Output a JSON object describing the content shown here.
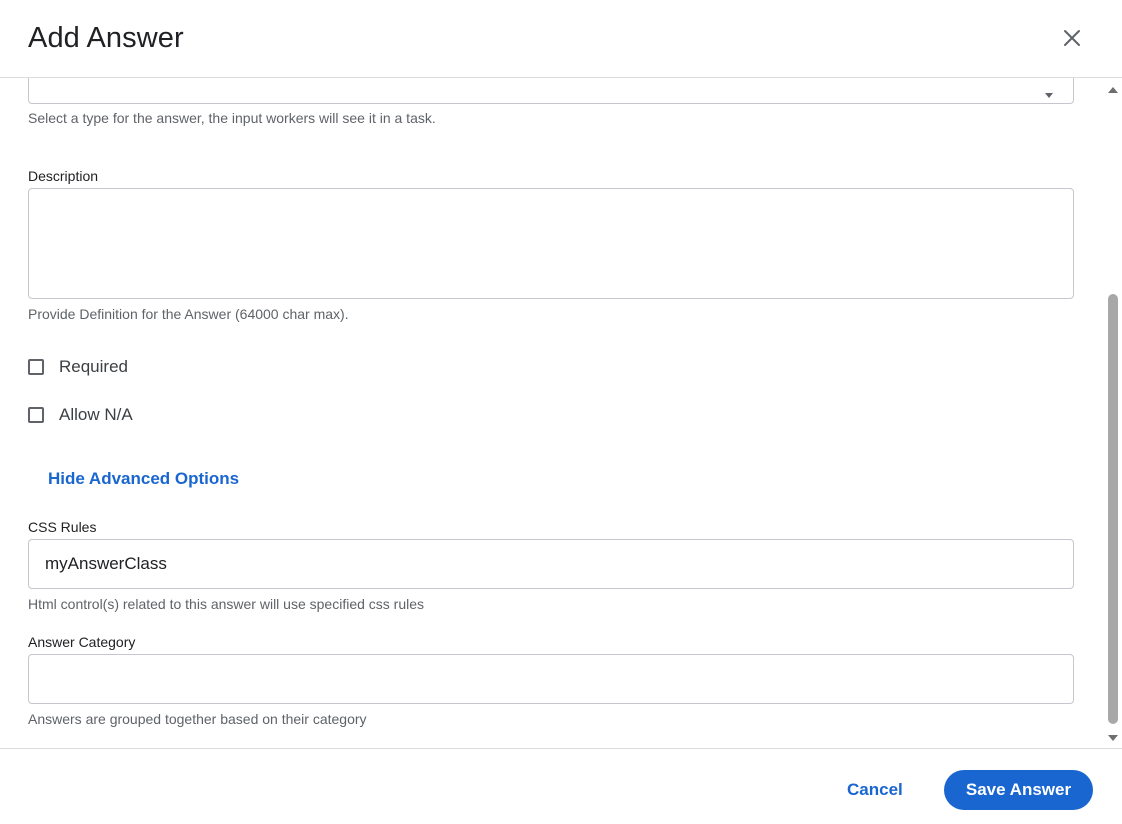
{
  "dialog": {
    "title": "Add Answer",
    "close_icon": "close-icon"
  },
  "form": {
    "type_hint": "Select a type for the answer, the input workers will see it in a task.",
    "description": {
      "label": "Description",
      "value": "",
      "hint": "Provide Definition for the Answer (64000 char max)."
    },
    "required": {
      "label": "Required",
      "checked": false
    },
    "allow_na": {
      "label": "Allow N/A",
      "checked": false
    },
    "advanced_toggle_label": "Hide Advanced Options",
    "css_rules": {
      "label": "CSS Rules",
      "value": "myAnswerClass",
      "hint": "Html control(s) related to this answer will use specified css rules"
    },
    "answer_category": {
      "label": "Answer Category",
      "value": "",
      "hint": "Answers are grouped together based on their category"
    }
  },
  "footer": {
    "cancel_label": "Cancel",
    "save_label": "Save Answer"
  },
  "colors": {
    "accent": "#1a66d0",
    "border": "#c4c7cc",
    "hint_text": "#5f6368"
  }
}
